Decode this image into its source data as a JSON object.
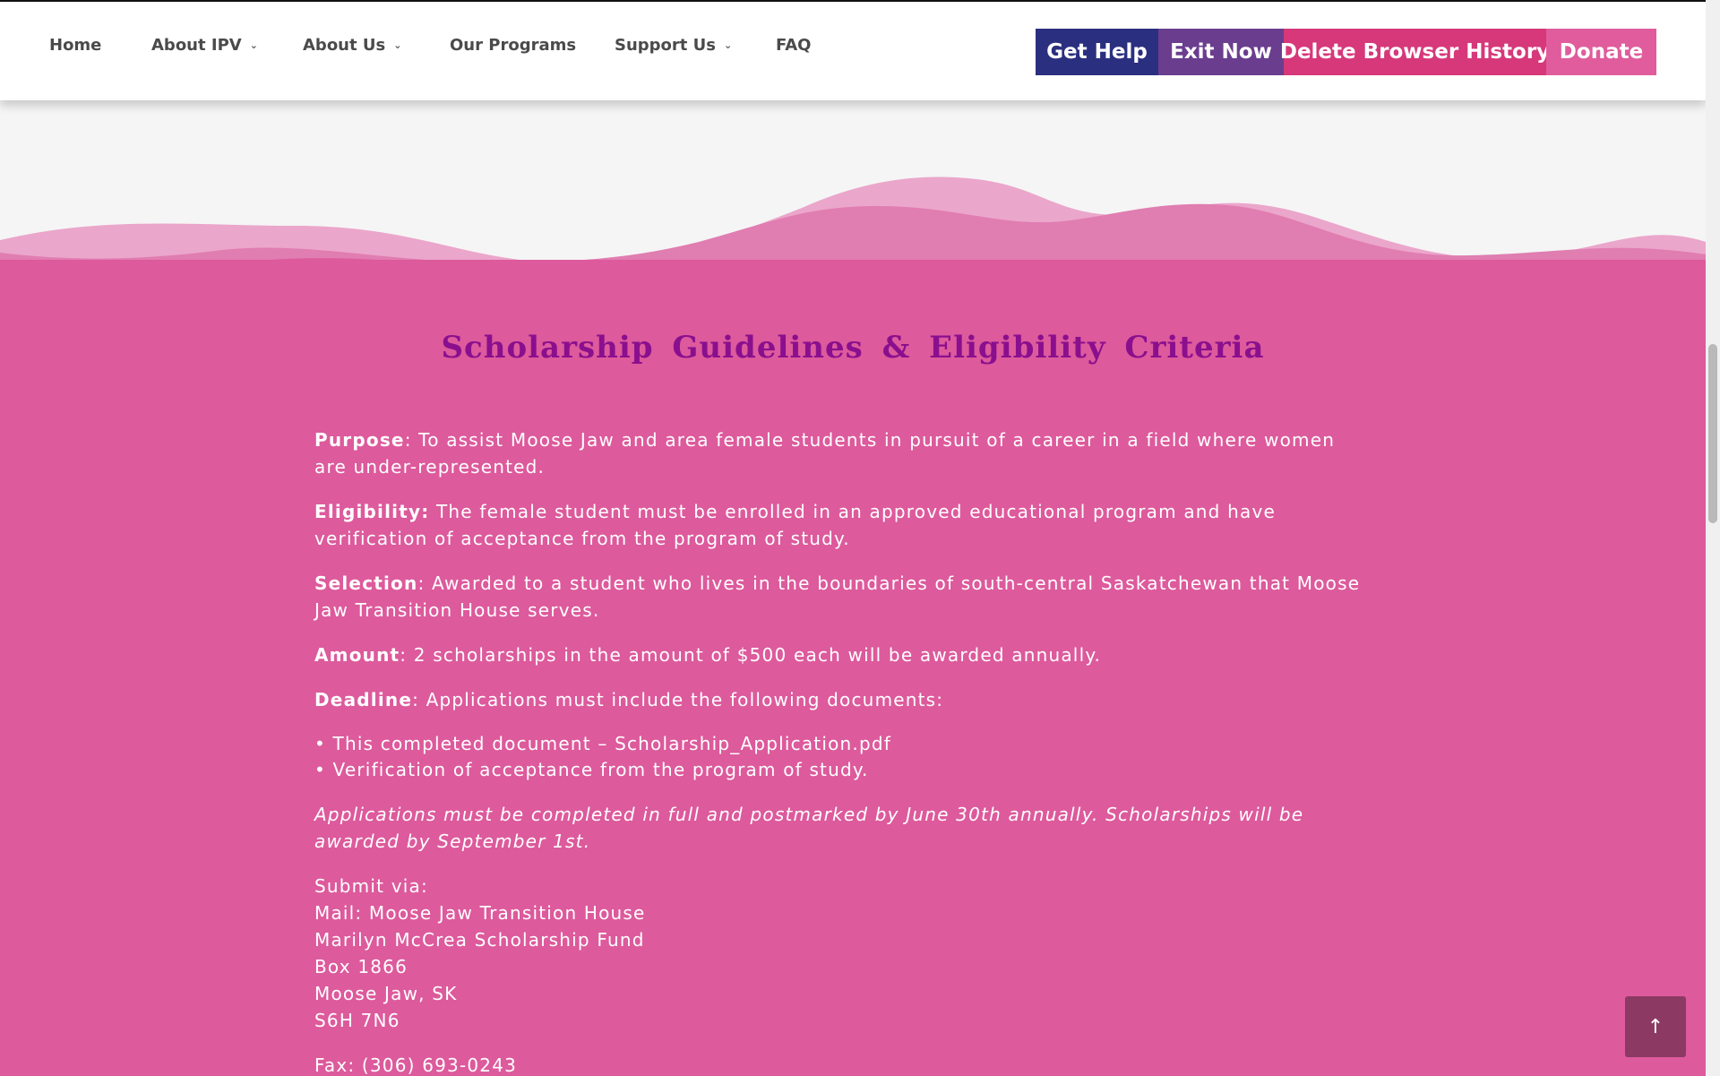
{
  "nav": {
    "items": [
      {
        "label": "Home",
        "has_dropdown": false
      },
      {
        "label": "About IPV",
        "has_dropdown": true
      },
      {
        "label": "About Us",
        "has_dropdown": true
      },
      {
        "label": "Our Programs",
        "has_dropdown": false
      },
      {
        "label": "Support Us",
        "has_dropdown": true
      },
      {
        "label": "FAQ",
        "has_dropdown": false
      }
    ]
  },
  "actions": {
    "get_help": "Get Help",
    "exit_now": "Exit Now",
    "delete_history": "Delete Browser History",
    "donate": "Donate"
  },
  "colors": {
    "get_help": "#2b2f7f",
    "exit_now": "#6a3d8f",
    "delete_history": "#d6387a",
    "donate": "#e05c9c",
    "section_bg": "#dd5a9c",
    "heading": "#8a0f8e"
  },
  "section": {
    "heading": "Scholarship Guidelines & Eligibility Criteria",
    "purpose_label": "Purpose",
    "purpose_text": ": To assist Moose Jaw and area female students in pursuit of a career in a field where women are under-represented.",
    "eligibility_label": "Eligibility:",
    "eligibility_text": " The female student must be enrolled in an approved educational program and have verification of acceptance from the program of study.",
    "selection_label": "Selection",
    "selection_text": ": Awarded to a student who lives in the boundaries of south-central Saskatchewan that Moose Jaw Transition House serves.",
    "amount_label": "Amount",
    "amount_text": ": 2 scholarships in the amount of $500 each will be awarded annually.",
    "deadline_label": "Deadline",
    "deadline_text": ": Applications must include the following documents:",
    "bullets": [
      "• This completed document – Scholarship_Application.pdf",
      "• Verification of acceptance from the program of study."
    ],
    "note": "Applications must be completed in full and postmarked by June 30th annually. Scholarships will be awarded by September 1st.",
    "submit_lines": [
      "Submit via:",
      "Mail: Moose Jaw Transition House",
      "Marilyn McCrea Scholarship Fund",
      "Box 1866",
      "Moose Jaw, SK",
      "S6H 7N6"
    ],
    "fax": "Fax: (306) 693-0243"
  },
  "back_to_top": {
    "icon": "arrow-up-icon",
    "glyph": "↑"
  }
}
